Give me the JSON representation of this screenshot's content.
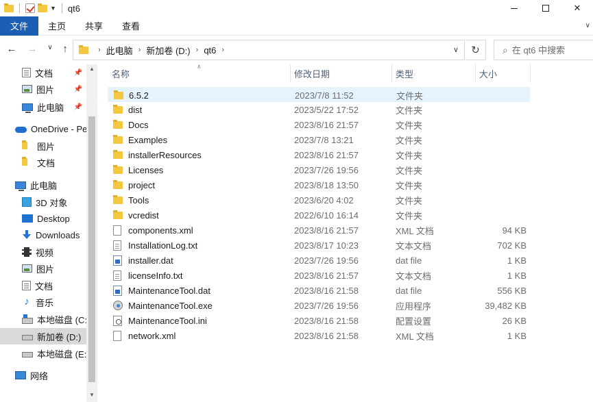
{
  "window": {
    "title": "qt6",
    "minimize_icon": "minimize-icon",
    "maximize_icon": "maximize-icon",
    "close_glyph": "✕"
  },
  "ribbon": {
    "tabs": [
      "文件",
      "主页",
      "共享",
      "查看"
    ]
  },
  "nav": {
    "back": "←",
    "forward": "→",
    "recent": "∨",
    "up": "↑",
    "breadcrumb": [
      "此电脑",
      "新加卷 (D:)",
      "qt6"
    ],
    "search_placeholder": "在 qt6 中搜索",
    "refresh_glyph": "↻"
  },
  "sidebar": {
    "items": [
      {
        "label": "文档",
        "icon": "document-icon",
        "pinned": true
      },
      {
        "label": "图片",
        "icon": "picture-icon",
        "pinned": true
      },
      {
        "label": "此电脑",
        "icon": "computer-icon",
        "pinned": true
      },
      {
        "label": "OneDrive - Pe",
        "icon": "cloud-icon"
      },
      {
        "label": "图片",
        "icon": "folder-icon"
      },
      {
        "label": "文档",
        "icon": "folder-icon"
      },
      {
        "label": "此电脑",
        "icon": "computer-icon"
      },
      {
        "label": "3D 对象",
        "icon": "3d-objects-icon"
      },
      {
        "label": "Desktop",
        "icon": "desktop-icon"
      },
      {
        "label": "Downloads",
        "icon": "download-icon"
      },
      {
        "label": "视频",
        "icon": "video-icon"
      },
      {
        "label": "图片",
        "icon": "picture-icon"
      },
      {
        "label": "文档",
        "icon": "document-icon"
      },
      {
        "label": "音乐",
        "icon": "music-icon"
      },
      {
        "label": "本地磁盘 (C:)",
        "icon": "windows-drive-icon"
      },
      {
        "label": "新加卷 (D:)",
        "icon": "drive-icon"
      },
      {
        "label": "本地磁盘 (E:)",
        "icon": "drive-icon"
      },
      {
        "label": "网络",
        "icon": "network-icon"
      }
    ]
  },
  "columns": {
    "name": "名称",
    "date": "修改日期",
    "type": "类型",
    "size": "大小"
  },
  "files": [
    {
      "name": "6.5.2",
      "date": "2023/7/8 11:52",
      "type": "文件夹",
      "size": "",
      "icon": "folder-icon"
    },
    {
      "name": "dist",
      "date": "2023/5/22 17:52",
      "type": "文件夹",
      "size": "",
      "icon": "folder-icon"
    },
    {
      "name": "Docs",
      "date": "2023/8/16 21:57",
      "type": "文件夹",
      "size": "",
      "icon": "folder-icon"
    },
    {
      "name": "Examples",
      "date": "2023/7/8 13:21",
      "type": "文件夹",
      "size": "",
      "icon": "folder-icon"
    },
    {
      "name": "installerResources",
      "date": "2023/8/16 21:57",
      "type": "文件夹",
      "size": "",
      "icon": "folder-icon"
    },
    {
      "name": "Licenses",
      "date": "2023/7/26 19:56",
      "type": "文件夹",
      "size": "",
      "icon": "folder-icon"
    },
    {
      "name": "project",
      "date": "2023/8/18 13:50",
      "type": "文件夹",
      "size": "",
      "icon": "folder-icon"
    },
    {
      "name": "Tools",
      "date": "2023/6/20 4:02",
      "type": "文件夹",
      "size": "",
      "icon": "folder-icon"
    },
    {
      "name": "vcredist",
      "date": "2022/6/10 16:14",
      "type": "文件夹",
      "size": "",
      "icon": "folder-icon"
    },
    {
      "name": "components.xml",
      "date": "2023/8/16 21:57",
      "type": "XML 文档",
      "size": "94 KB",
      "icon": "file-icon"
    },
    {
      "name": "InstallationLog.txt",
      "date": "2023/8/17 10:23",
      "type": "文本文档",
      "size": "702 KB",
      "icon": "text-file-icon"
    },
    {
      "name": "installer.dat",
      "date": "2023/7/26 19:56",
      "type": "dat file",
      "size": "1 KB",
      "icon": "dat-file-icon"
    },
    {
      "name": "licenseInfo.txt",
      "date": "2023/8/16 21:57",
      "type": "文本文档",
      "size": "1 KB",
      "icon": "text-file-icon"
    },
    {
      "name": "MaintenanceTool.dat",
      "date": "2023/8/16 21:58",
      "type": "dat file",
      "size": "556 KB",
      "icon": "dat-file-icon"
    },
    {
      "name": "MaintenanceTool.exe",
      "date": "2023/7/26 19:56",
      "type": "应用程序",
      "size": "39,482 KB",
      "icon": "exe-icon"
    },
    {
      "name": "MaintenanceTool.ini",
      "date": "2023/8/16 21:58",
      "type": "配置设置",
      "size": "26 KB",
      "icon": "ini-file-icon"
    },
    {
      "name": "network.xml",
      "date": "2023/8/16 21:58",
      "type": "XML 文档",
      "size": "1 KB",
      "icon": "file-icon"
    }
  ]
}
